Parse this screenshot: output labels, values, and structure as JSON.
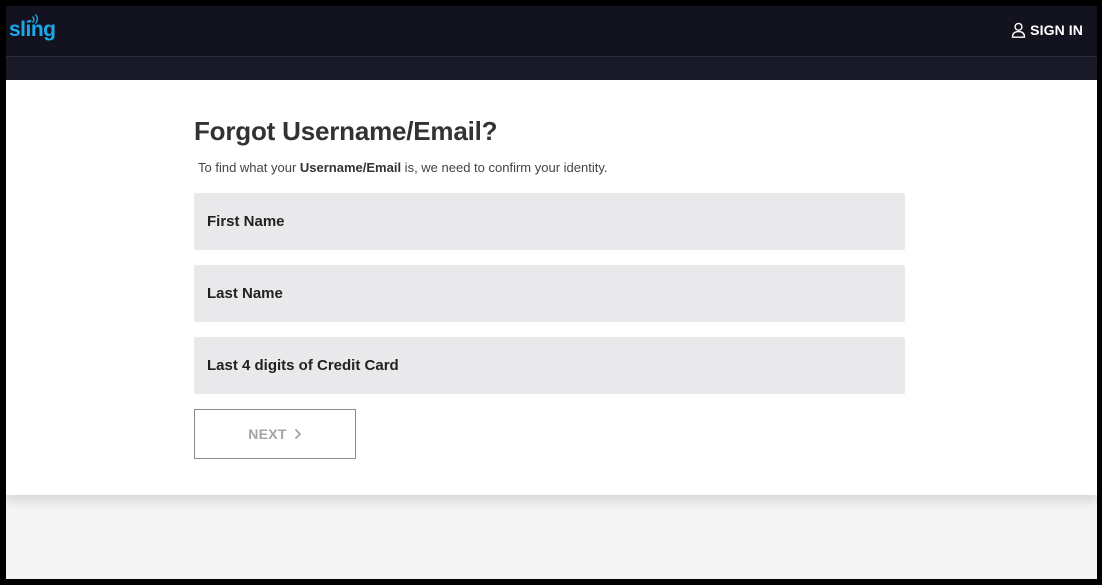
{
  "header": {
    "logo_text": "sling",
    "signin_label": "SIGN IN"
  },
  "form": {
    "title": "Forgot Username/Email?",
    "subtitle_pre": "To find what your ",
    "subtitle_bold": "Username/Email",
    "subtitle_post": " is, we need to confirm your identity.",
    "first_name_placeholder": "First Name",
    "last_name_placeholder": "Last Name",
    "cc_placeholder": "Last 4 digits of Credit Card",
    "next_label": "NEXT"
  },
  "colors": {
    "brand_blue": "#1aa8e8",
    "header_bg": "#13131f",
    "field_bg": "#e9e9eb",
    "disabled_text": "#a3a3a3"
  },
  "icons": {
    "account": "user-outline-icon",
    "next": "chevron-right-icon"
  }
}
